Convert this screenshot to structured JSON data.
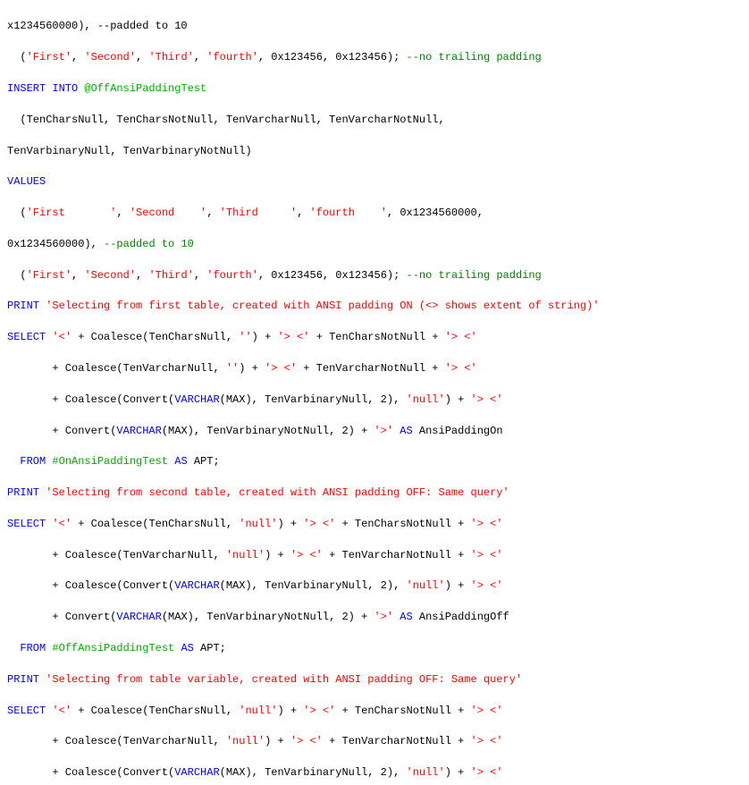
{
  "code": {
    "lines": [
      {
        "id": "l1",
        "parts": [
          {
            "text": "x1234560000), --padded to 10",
            "type": "normal"
          }
        ]
      },
      {
        "id": "l2",
        "parts": [
          {
            "text": "  ('First', 'Second', 'Third', 'fourth', 0x123456, 0x123456); --no trailing padding",
            "type": "mixed"
          }
        ]
      },
      {
        "id": "l3",
        "parts": [
          {
            "text": "INSERT INTO @OffAnsiPaddingTest",
            "type": "mixed"
          }
        ]
      },
      {
        "id": "l4",
        "parts": [
          {
            "text": "  (TenCharsNull, TenCharsNotNull, TenVarcharNull, TenVarcharNotNull,",
            "type": "normal"
          }
        ]
      },
      {
        "id": "l5",
        "parts": [
          {
            "text": "TenVarbinaryNull, TenVarbinaryNotNull)",
            "type": "normal"
          }
        ]
      },
      {
        "id": "l6",
        "parts": [
          {
            "text": "VALUES",
            "type": "kw"
          }
        ]
      },
      {
        "id": "l7",
        "parts": [
          {
            "text": "  ('First       ', 'Second    ', 'Third     ', 'fourth    ', 0x1234560000,",
            "type": "mixed"
          }
        ]
      },
      {
        "id": "l8",
        "parts": [
          {
            "text": "0x1234560000), --padded to 10",
            "type": "normal"
          }
        ]
      },
      {
        "id": "l9",
        "parts": [
          {
            "text": "  ('First', 'Second', 'Third', 'fourth', 0x123456, 0x123456); --no trailing padding",
            "type": "mixed"
          }
        ]
      },
      {
        "id": "l10",
        "parts": [
          {
            "text": "PRINT 'Selecting from first table, created with ANSI padding ON (<> shows extent of string)'",
            "type": "mixed"
          }
        ]
      },
      {
        "id": "l11",
        "parts": [
          {
            "text": "SELECT '<' + Coalesce(TenCharsNull, '') + '> <' + TenCharsNotNull + '> <'",
            "type": "mixed"
          }
        ]
      },
      {
        "id": "l12",
        "parts": [
          {
            "text": "       + Coalesce(TenVarcharNull, '') + '> <' + TenVarcharNotNull + '> <'",
            "type": "mixed"
          }
        ]
      },
      {
        "id": "l13",
        "parts": [
          {
            "text": "       + Coalesce(Convert(VARCHAR(MAX), TenVarbinaryNull, 2), 'null') + '> <'",
            "type": "mixed"
          }
        ]
      },
      {
        "id": "l14",
        "parts": [
          {
            "text": "       + Convert(VARCHAR(MAX), TenVarbinaryNotNull, 2) + '>' AS AnsiPaddingOn",
            "type": "mixed"
          }
        ]
      },
      {
        "id": "l15",
        "parts": [
          {
            "text": "  FROM #OnAnsiPaddingTest AS APT;",
            "type": "mixed"
          }
        ]
      },
      {
        "id": "l16",
        "parts": [
          {
            "text": "PRINT 'Selecting from second table, created with ANSI padding OFF: Same query'",
            "type": "mixed"
          }
        ]
      },
      {
        "id": "l17",
        "parts": [
          {
            "text": "SELECT '<' + Coalesce(TenCharsNull, 'null') + '> <' + TenCharsNotNull + '> <'",
            "type": "mixed"
          }
        ]
      },
      {
        "id": "l18",
        "parts": [
          {
            "text": "       + Coalesce(TenVarcharNull, 'null') + '> <' + TenVarcharNotNull + '> <'",
            "type": "mixed"
          }
        ]
      },
      {
        "id": "l19",
        "parts": [
          {
            "text": "       + Coalesce(Convert(VARCHAR(MAX), TenVarbinaryNull, 2), 'null') + '> <'",
            "type": "mixed"
          }
        ]
      },
      {
        "id": "l20",
        "parts": [
          {
            "text": "       + Convert(VARCHAR(MAX), TenVarbinaryNotNull, 2) + '>' AS AnsiPaddingOff",
            "type": "mixed"
          }
        ]
      },
      {
        "id": "l21",
        "parts": [
          {
            "text": "  FROM #OffAnsiPaddingTest AS APT;",
            "type": "mixed"
          }
        ]
      },
      {
        "id": "l22",
        "parts": [
          {
            "text": "PRINT 'Selecting from table variable, created with ANSI padding OFF: Same query'",
            "type": "mixed"
          }
        ]
      },
      {
        "id": "l23",
        "parts": [
          {
            "text": "SELECT '<' + Coalesce(TenCharsNull, 'null') + '> <' + TenCharsNotNull + '> <'",
            "type": "mixed"
          }
        ]
      },
      {
        "id": "l24",
        "parts": [
          {
            "text": "       + Coalesce(TenVarcharNull, 'null') + '> <' + TenVarcharNotNull + '> <'",
            "type": "mixed"
          }
        ]
      },
      {
        "id": "l25",
        "parts": [
          {
            "text": "       + Coalesce(Convert(VARCHAR(MAX), TenVarbinaryNull, 2), 'null') + '> <'",
            "type": "mixed"
          }
        ]
      }
    ]
  }
}
